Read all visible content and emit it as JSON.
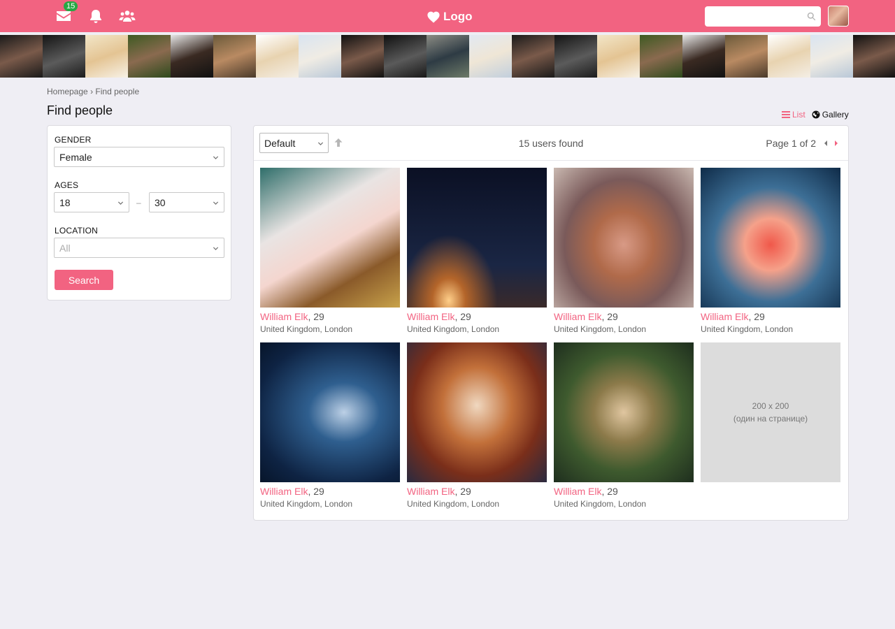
{
  "header": {
    "logo_text": "Logo",
    "messages_count": "15",
    "search_placeholder": "",
    "accent_color": "#f26381",
    "badge_color": "#27a844",
    "icons": [
      "envelope-icon",
      "bell-icon",
      "users-icon",
      "heart-icon",
      "search-icon"
    ]
  },
  "strip": {
    "count": 21
  },
  "breadcrumb": {
    "home": "Homepage",
    "separator": "›",
    "current": "Find people"
  },
  "page_title": "Find people",
  "view_toggle": {
    "list": "List",
    "gallery": "Gallery",
    "active": "list"
  },
  "filter": {
    "gender_label": "GENDER",
    "gender_value": "Female",
    "ages_label": "AGES",
    "age_from": "18",
    "age_separator": "–",
    "age_to": "30",
    "location_label": "LOCATION",
    "location_value": "All",
    "search_button": "Search"
  },
  "results": {
    "sort_value": "Default",
    "count_text": "15 users found",
    "page_text": "Page 1 of 2",
    "users": [
      {
        "name": "William Elk",
        "age": ", 29",
        "location": "United Kingdom, London",
        "photo": "sushi"
      },
      {
        "name": "William Elk",
        "age": ", 29",
        "location": "United Kingdom, London",
        "photo": "rocket"
      },
      {
        "name": "William Elk",
        "age": ", 29",
        "location": "United Kingdom, London",
        "photo": "redhead"
      },
      {
        "name": "William Elk",
        "age": ", 29",
        "location": "United Kingdom, London",
        "photo": "jellyfish"
      },
      {
        "name": "William Elk",
        "age": ", 29",
        "location": "United Kingdom, London",
        "photo": "floating"
      },
      {
        "name": "William Elk",
        "age": ", 29",
        "location": "United Kingdom, London",
        "photo": "autumn"
      },
      {
        "name": "William Elk",
        "age": ", 29",
        "location": "United Kingdom, London",
        "photo": "foliage"
      }
    ],
    "ad": {
      "size_text": "200 x 200",
      "note_text": "(один на странице)"
    }
  }
}
